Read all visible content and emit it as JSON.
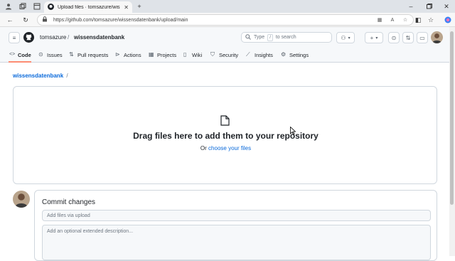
{
  "browser": {
    "tab_title": "Upload files · tomsazure/wissensd",
    "url": "https://github.com/tomsazure/wissensdatenbank/upload/main"
  },
  "header": {
    "owner": "tomsazure",
    "separator": "/",
    "repo": "wissensdatenbank",
    "search_text": "Type",
    "search_key": "/",
    "search_suffix": "to search"
  },
  "nav": {
    "code": "Code",
    "issues": "Issues",
    "pull_requests": "Pull requests",
    "actions": "Actions",
    "projects": "Projects",
    "wiki": "Wiki",
    "security": "Security",
    "insights": "Insights",
    "settings": "Settings"
  },
  "breadcrumb": {
    "repo": "wissensdatenbank",
    "separator": "/"
  },
  "dropzone": {
    "title": "Drag files here to add them to your repository",
    "or": "Or",
    "choose": "choose your files"
  },
  "commit": {
    "title": "Commit changes",
    "summary_placeholder": "Add files via upload",
    "description_placeholder": "Add an optional extended description..."
  },
  "colors": {
    "accent": "#0969da",
    "nav_underline": "#fd8c73",
    "border": "#d0d7de"
  }
}
